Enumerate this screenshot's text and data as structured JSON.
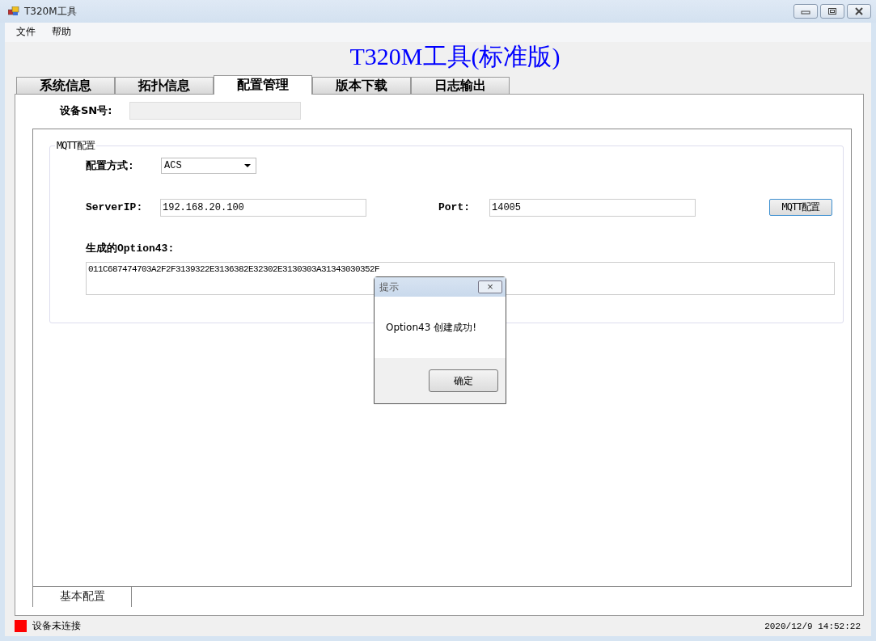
{
  "window": {
    "title": "T320M工具"
  },
  "menu": [
    "文件",
    "帮助"
  ],
  "app_title": "T320M工具(标准版)",
  "tabs": [
    {
      "label": "系统信息",
      "selected": false
    },
    {
      "label": "拓扑信息",
      "selected": false
    },
    {
      "label": "配置管理",
      "selected": true
    },
    {
      "label": "版本下载",
      "selected": false
    },
    {
      "label": "日志输出",
      "selected": false
    }
  ],
  "device_sn": {
    "label": "设备SN号:"
  },
  "mqtt_group": {
    "title": "MQTT配置",
    "mode_label": "配置方式:",
    "mode_value": "ACS",
    "server_label": "ServerIP:",
    "server_value": "192.168.20.100",
    "port_label": "Port:",
    "port_value": "14005",
    "button": "MQTT配置",
    "option_label": "生成的Option43:",
    "option_value": "011C687474703A2F2F3139322E3136382E32302E3130303A31343030352F"
  },
  "bottom_tabs": [
    {
      "label": "基本配置",
      "selected": true
    }
  ],
  "dialog": {
    "title": "提示",
    "close": "×",
    "message": "Option43 创建成功!",
    "button": "确定"
  },
  "status_bar": {
    "connected": false,
    "text": "设备未连接",
    "time": "2020/12/9 14:52:22"
  }
}
